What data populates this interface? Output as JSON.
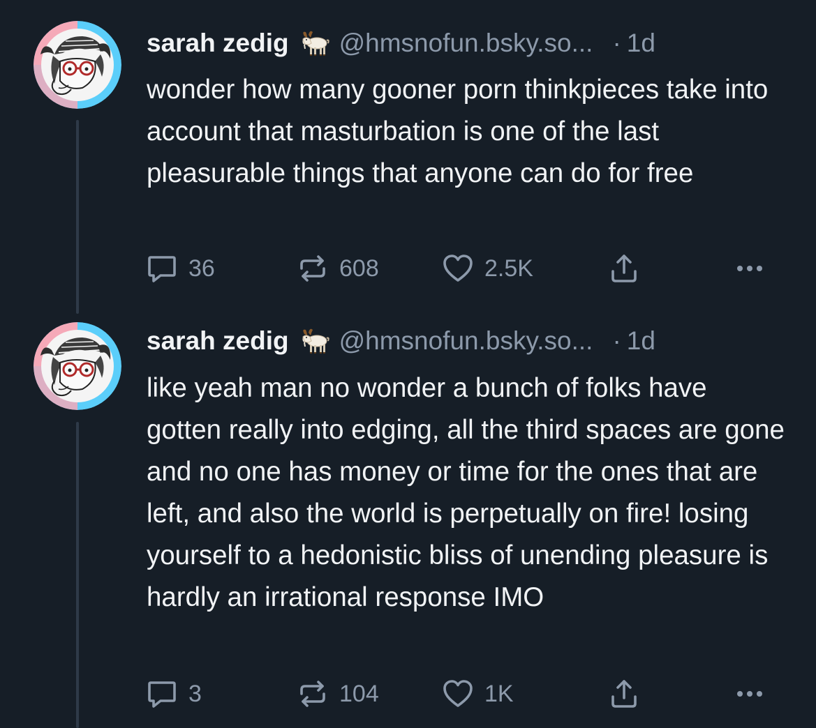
{
  "colors": {
    "background": "#161e27",
    "text": "#f1f3f5",
    "muted": "#8d9aab",
    "thread_line": "#2e3a48",
    "avatar_ring_blue": "#5bcefa",
    "avatar_ring_pink": "#f5a9b8"
  },
  "posts": [
    {
      "author": {
        "display_name": "sarah zedig",
        "emoji_icon": "goat-icon",
        "handle": "@hmsnofun.bsky.so..."
      },
      "dot": "·",
      "time": "1d",
      "text": "wonder how many gooner porn thinkpieces take into account that masturbation is one of the last pleasurable things that anyone can do for free",
      "actions": {
        "replies": "36",
        "reposts": "608",
        "likes": "2.5K"
      }
    },
    {
      "author": {
        "display_name": "sarah zedig",
        "emoji_icon": "goat-icon",
        "handle": "@hmsnofun.bsky.so..."
      },
      "dot": "·",
      "time": "1d",
      "text": "like yeah man no wonder a bunch of folks have gotten really into edging, all the third spaces are gone and no one has money or time for the ones that are left, and also the world is perpetually on fire! losing yourself to a hedonistic bliss of unending pleasure is hardly an irrational response IMO",
      "actions": {
        "replies": "3",
        "reposts": "104",
        "likes": "1K"
      }
    }
  ]
}
